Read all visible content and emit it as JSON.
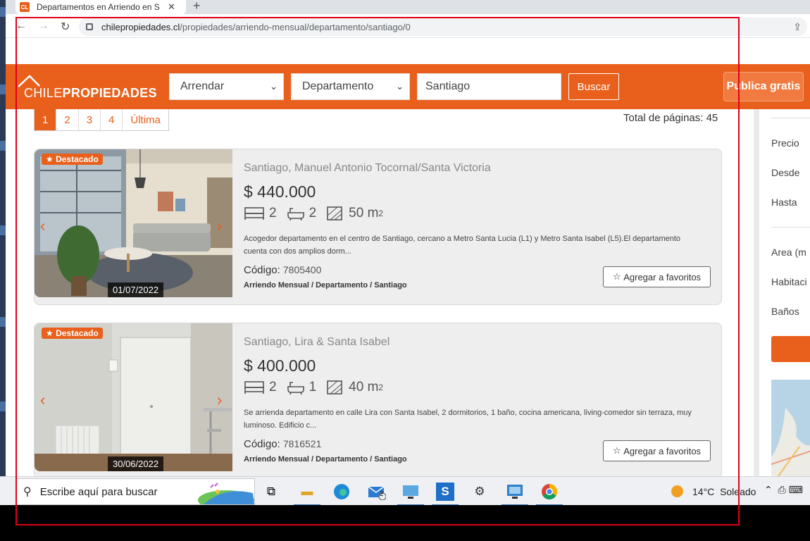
{
  "browser": {
    "tab_title": "Departamentos en Arriendo en S",
    "tab_favicon": "CL",
    "url_domain": "chilepropiedades.cl",
    "url_path": "/propiedades/arriendo-mensual/departamento/santiago/0"
  },
  "header": {
    "logo_light": "CHILE",
    "logo_bold": "PROPIEDADES",
    "operation_select": "Arrendar",
    "type_select": "Departamento",
    "location_input": "Santiago",
    "search_button": "Buscar",
    "publish_button": "Publica gratis"
  },
  "pagination": {
    "pages": [
      "1",
      "2",
      "3",
      "4",
      "Última"
    ],
    "active": "1",
    "total_label": "Total de páginas: 45"
  },
  "listings": [
    {
      "badge": "Destacado",
      "date": "01/07/2022",
      "address": "Santiago, Manuel Antonio Tocornal/Santa Victoria",
      "price": "$ 440.000",
      "bedrooms": "2",
      "bathrooms": "2",
      "area_value": "50 m",
      "area_sup": "2",
      "description": "Acogedor departamento en el centro de Santiago, cercano a Metro Santa Lucia (L1) y Metro Santa Isabel (L5).El departamento cuenta con dos amplios dorm...",
      "code_label": "Código:",
      "code": "7805400",
      "breadcrumb": "Arriendo Mensual / Departamento / Santiago",
      "favorite_button": "Agregar a favoritos"
    },
    {
      "badge": "Destacado",
      "date": "30/06/2022",
      "address": "Santiago, Lira & Santa Isabel",
      "price": "$ 400.000",
      "bedrooms": "2",
      "bathrooms": "1",
      "area_value": "40 m",
      "area_sup": "2",
      "description": "Se arrienda departamento en calle Lira con Santa Isabel, 2 dormitorios, 1 baño, cocina americana, living-comedor sin terraza, muy luminoso. Edificio c...",
      "code_label": "Código:",
      "code": "7816521",
      "breadcrumb": "Arriendo Mensual / Departamento / Santiago",
      "favorite_button": "Agregar a favoritos"
    }
  ],
  "sidebar": {
    "price_label": "Precio",
    "from_label": "Desde",
    "to_label": "Hasta",
    "area_label": "Area (m",
    "rooms_label": "Habitaci",
    "baths_label": "Baños"
  },
  "taskbar": {
    "search_placeholder": "Escribe aquí para buscar",
    "mail_badge": "2",
    "temperature": "14°C",
    "weather": "Soleado"
  },
  "colors": {
    "brand_orange": "#e8601c",
    "highlight_border": "#e0001a"
  }
}
